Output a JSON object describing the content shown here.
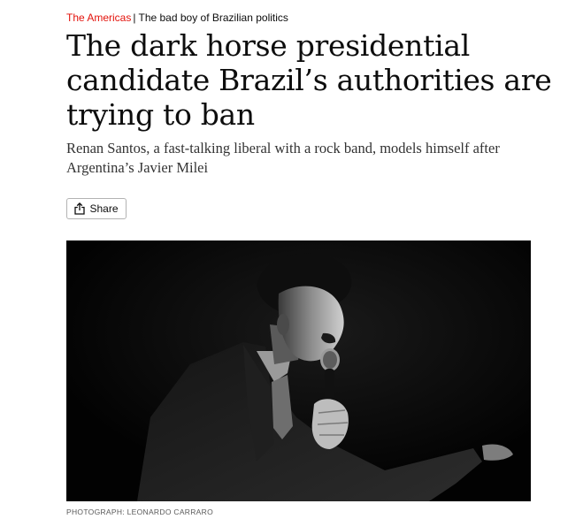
{
  "kicker": {
    "section": "The Americas",
    "separator": "|",
    "fly_title": "The bad boy of Brazilian politics"
  },
  "article": {
    "headline": "The dark horse presidential candidate Brazil’s authorities are trying to ban",
    "standfirst": "Renan Santos, a fast-talking liberal with a rock band, models himself after Argentina’s Javier Milei"
  },
  "share": {
    "label": "Share",
    "icon": "share-icon"
  },
  "image": {
    "credit": "PHOTOGRAPH: LEONARDO CARRARO"
  },
  "colors": {
    "section_red": "#e3120b",
    "text": "#0d0d0d",
    "standfirst": "#333333",
    "credit": "#595959"
  }
}
